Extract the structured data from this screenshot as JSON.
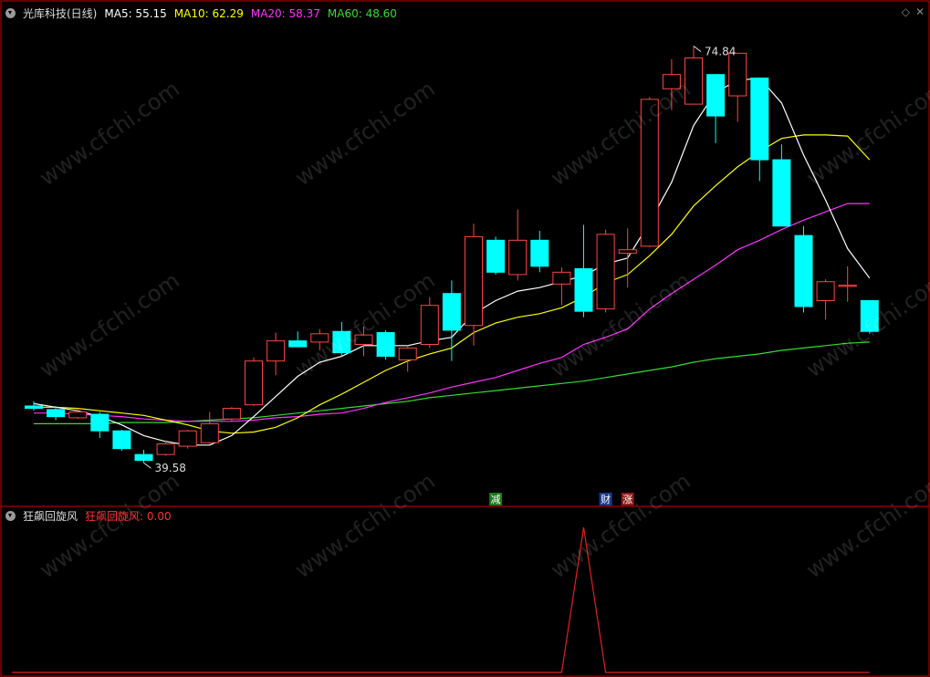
{
  "header": {
    "stock_title": "光库科技(日线)",
    "ma_items": [
      {
        "label": "MA5: 55.15",
        "color": "#ffffff"
      },
      {
        "label": "MA10: 62.29",
        "color": "#ffff00"
      },
      {
        "label": "MA20: 58.37",
        "color": "#ff33ff"
      },
      {
        "label": "MA60: 48.60",
        "color": "#33dd33"
      }
    ]
  },
  "indicator": {
    "title": "狂飙回旋风",
    "value_label": "狂飙回旋风: 0.00",
    "value_color": "#ff3030"
  },
  "watermark": "www.cfchi.com",
  "annotations": {
    "high": "74.84",
    "low": "39.58"
  },
  "markers": [
    {
      "text": "减",
      "bg": "#1a7a1a",
      "fg": "#ffffff"
    },
    {
      "text": "财",
      "bg": "#1a3a8a",
      "fg": "#ffffff"
    },
    {
      "text": "涨",
      "bg": "#8a1a1a",
      "fg": "#ffffff"
    }
  ],
  "colors": {
    "up": "#ff4444",
    "down": "#00ffff",
    "ma5": "#ffffff",
    "ma10": "#ffff00",
    "ma20": "#ff33ff",
    "ma60": "#33dd33",
    "separator": "#cc0000"
  },
  "chart_data": {
    "type": "candlestick",
    "y_range": [
      38.0,
      77.0
    ],
    "candles": [
      {
        "o": 44.4,
        "h": 44.8,
        "l": 44.0,
        "c": 44.2
      },
      {
        "o": 44.1,
        "h": 44.4,
        "l": 43.2,
        "c": 43.5
      },
      {
        "o": 43.4,
        "h": 44.2,
        "l": 43.3,
        "c": 43.9
      },
      {
        "o": 43.7,
        "h": 43.9,
        "l": 41.7,
        "c": 42.3
      },
      {
        "o": 42.3,
        "h": 42.4,
        "l": 40.6,
        "c": 40.8
      },
      {
        "o": 40.3,
        "h": 40.7,
        "l": 39.6,
        "c": 39.8
      },
      {
        "o": 40.3,
        "h": 41.5,
        "l": 40.2,
        "c": 41.2
      },
      {
        "o": 41.0,
        "h": 42.4,
        "l": 40.8,
        "c": 42.3
      },
      {
        "o": 41.3,
        "h": 43.9,
        "l": 41.2,
        "c": 42.9
      },
      {
        "o": 43.3,
        "h": 44.3,
        "l": 43.1,
        "c": 44.2
      },
      {
        "o": 44.5,
        "h": 48.5,
        "l": 44.4,
        "c": 48.2
      },
      {
        "o": 48.2,
        "h": 50.6,
        "l": 47.0,
        "c": 49.9
      },
      {
        "o": 49.9,
        "h": 50.7,
        "l": 49.4,
        "c": 49.4
      },
      {
        "o": 49.8,
        "h": 50.9,
        "l": 49.1,
        "c": 50.5
      },
      {
        "o": 50.7,
        "h": 51.5,
        "l": 48.6,
        "c": 48.9
      },
      {
        "o": 49.6,
        "h": 51.1,
        "l": 48.6,
        "c": 50.4
      },
      {
        "o": 50.6,
        "h": 50.8,
        "l": 48.3,
        "c": 48.6
      },
      {
        "o": 48.3,
        "h": 49.5,
        "l": 47.3,
        "c": 49.3
      },
      {
        "o": 49.6,
        "h": 53.6,
        "l": 49.3,
        "c": 52.9
      },
      {
        "o": 53.9,
        "h": 55.0,
        "l": 48.2,
        "c": 50.8
      },
      {
        "o": 51.2,
        "h": 59.8,
        "l": 49.5,
        "c": 58.7
      },
      {
        "o": 58.4,
        "h": 58.7,
        "l": 55.5,
        "c": 55.7
      },
      {
        "o": 55.5,
        "h": 61.0,
        "l": 55.0,
        "c": 58.4
      },
      {
        "o": 58.4,
        "h": 59.2,
        "l": 55.7,
        "c": 56.2
      },
      {
        "o": 54.7,
        "h": 56.1,
        "l": 52.9,
        "c": 55.7
      },
      {
        "o": 56.0,
        "h": 59.7,
        "l": 51.9,
        "c": 52.4
      },
      {
        "o": 52.6,
        "h": 59.3,
        "l": 52.3,
        "c": 58.9
      },
      {
        "o": 57.3,
        "h": 59.4,
        "l": 54.4,
        "c": 57.6
      },
      {
        "o": 57.9,
        "h": 70.5,
        "l": 57.8,
        "c": 70.3
      },
      {
        "o": 71.2,
        "h": 73.7,
        "l": 69.4,
        "c": 72.4
      },
      {
        "o": 69.9,
        "h": 74.8,
        "l": 69.9,
        "c": 73.8
      },
      {
        "o": 72.4,
        "h": 72.4,
        "l": 66.6,
        "c": 68.9
      },
      {
        "o": 70.6,
        "h": 74.2,
        "l": 68.4,
        "c": 74.2
      },
      {
        "o": 72.1,
        "h": 72.1,
        "l": 63.4,
        "c": 65.2
      },
      {
        "o": 65.2,
        "h": 66.5,
        "l": 59.9,
        "c": 59.6
      },
      {
        "o": 58.8,
        "h": 59.6,
        "l": 52.3,
        "c": 52.8
      },
      {
        "o": 53.3,
        "h": 55.1,
        "l": 51.7,
        "c": 54.9
      },
      {
        "o": 54.5,
        "h": 56.2,
        "l": 53.2,
        "c": 54.6
      },
      {
        "o": 53.3,
        "h": 53.3,
        "l": 50.5,
        "c": 50.7
      }
    ],
    "ma5": [
      44.6,
      44.3,
      44.0,
      43.5,
      42.8,
      41.9,
      41.4,
      41.1,
      41.1,
      41.9,
      43.5,
      45.2,
      46.9,
      48.1,
      48.6,
      49.5,
      49.5,
      49.5,
      49.9,
      50.2,
      52.2,
      53.3,
      54.1,
      54.4,
      54.9,
      55.4,
      56.4,
      56.9,
      59.9,
      63.3,
      68.1,
      70.9,
      71.9,
      72.1,
      70.0,
      65.6,
      61.8,
      57.7,
      55.2
    ],
    "ma10": [
      44.3,
      44.3,
      44.2,
      44.0,
      43.8,
      43.6,
      43.2,
      42.8,
      42.3,
      42.1,
      42.2,
      42.6,
      43.4,
      44.5,
      45.4,
      46.4,
      47.4,
      48.2,
      48.8,
      49.3,
      50.6,
      51.4,
      51.9,
      52.2,
      52.7,
      53.6,
      54.8,
      55.5,
      57.1,
      58.9,
      61.3,
      63.0,
      64.6,
      65.9,
      67.0,
      67.3,
      67.3,
      67.2,
      65.2
    ],
    "ma20": [
      43.8,
      43.8,
      43.7,
      43.6,
      43.5,
      43.3,
      43.2,
      43.1,
      43.1,
      43.1,
      43.2,
      43.4,
      43.5,
      43.7,
      43.8,
      44.2,
      44.7,
      45.1,
      45.5,
      46.0,
      46.4,
      46.8,
      47.4,
      48.0,
      48.5,
      49.6,
      50.2,
      50.9,
      52.6,
      53.9,
      55.1,
      56.3,
      57.6,
      58.4,
      59.3,
      60.1,
      60.8,
      61.5,
      61.5
    ],
    "ma60": [
      42.9,
      42.9,
      42.9,
      42.9,
      43.0,
      43.0,
      43.0,
      43.1,
      43.2,
      43.3,
      43.4,
      43.6,
      43.8,
      44.0,
      44.2,
      44.4,
      44.6,
      44.8,
      45.1,
      45.3,
      45.5,
      45.7,
      45.9,
      46.1,
      46.3,
      46.5,
      46.8,
      47.1,
      47.4,
      47.7,
      48.1,
      48.4,
      48.6,
      48.8,
      49.1,
      49.3,
      49.5,
      49.7,
      49.8
    ],
    "indicator_values": [
      0,
      0,
      0,
      0,
      0,
      0,
      0,
      0,
      0,
      0,
      0,
      0,
      0,
      0,
      0,
      0,
      0,
      0,
      0,
      0,
      0,
      0,
      0,
      0,
      0,
      1,
      0,
      0,
      0,
      0,
      0,
      0,
      0,
      0,
      0,
      0,
      0,
      0,
      0
    ],
    "indicator_range": [
      0,
      1
    ]
  }
}
